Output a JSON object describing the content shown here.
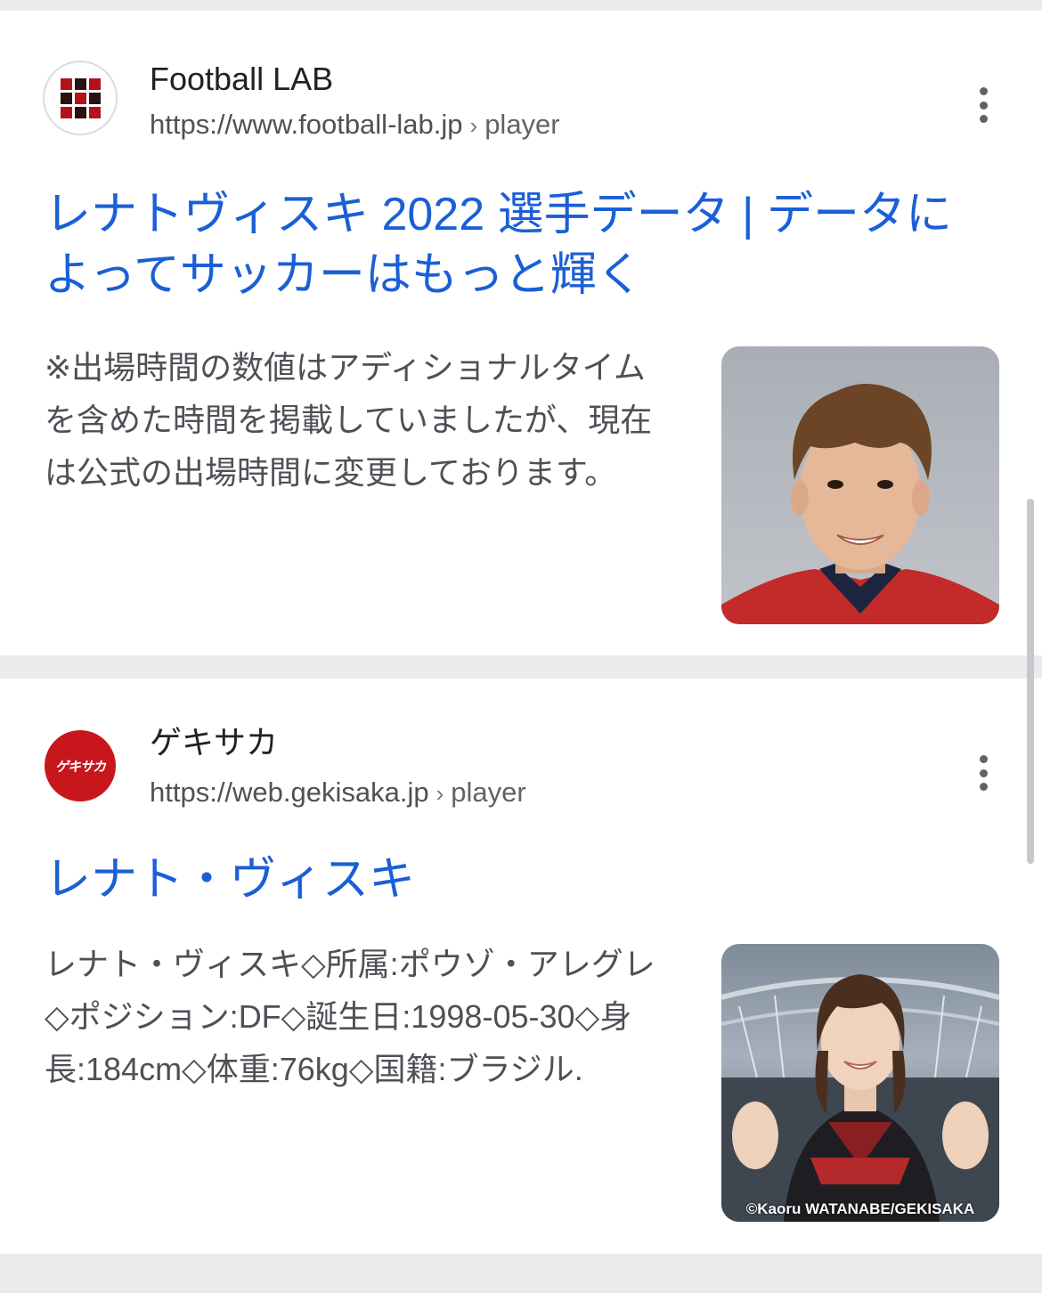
{
  "results": [
    {
      "site_name": "Football LAB",
      "url_host": "https://www.football-lab.jp",
      "url_separator": "›",
      "url_path": "player",
      "title": "レナトヴィスキ 2022 選手データ | データによってサッカーはもっと輝く",
      "snippet": "※出場時間の数値はアディショナルタイムを含めた時間を掲載していましたが、現在は公式の出場時間に変更しております。",
      "thumbnail_icon": "player-portrait-photo"
    },
    {
      "site_name": "ゲキサカ",
      "favicon_text": "ゲキサカ",
      "url_host": "https://web.gekisaka.jp",
      "url_separator": "›",
      "url_path": "player",
      "title": "レナト・ヴィスキ",
      "snippet": "レナト・ヴィスキ◇所属:ポウゾ・アレグレ◇ポジション:DF◇誕生日:1998-05-30◇身長:184cm◇体重:76kg◇国籍:ブラジル.",
      "thumbnail_icon": "stadium-woman-photo",
      "thumbnail_credit": "©Kaoru WATANABE/GEKISAKA"
    }
  ],
  "colors": {
    "link_title": "#1a5fd6",
    "snippet_text": "#4d5156",
    "page_background": "#ebebee"
  }
}
